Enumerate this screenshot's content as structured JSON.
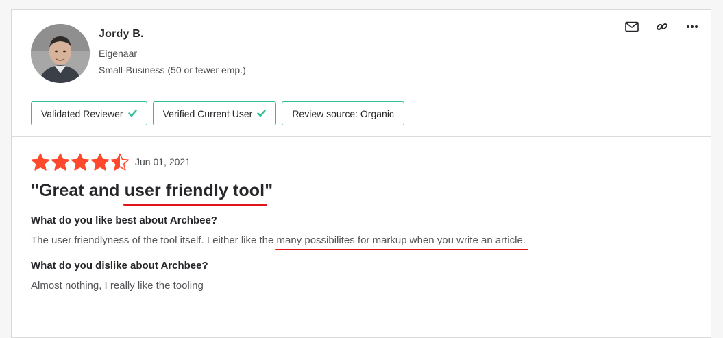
{
  "reviewer": {
    "name": "Jordy B.",
    "role": "Eigenaar",
    "company_size": "Small-Business (50 or fewer emp.)",
    "avatar_icon": "person-avatar"
  },
  "actions": [
    {
      "icon": "mail-icon"
    },
    {
      "icon": "link-icon"
    },
    {
      "icon": "more-icon"
    }
  ],
  "badges": [
    {
      "label": "Validated Reviewer",
      "check": true
    },
    {
      "label": "Verified Current User",
      "check": true
    },
    {
      "label": "Review source: Organic",
      "check": false
    }
  ],
  "colors": {
    "accent": "#2ebd97",
    "star": "#ff492c",
    "highlight": "#e3131c"
  },
  "review": {
    "rating": 4.5,
    "rating_max": 5,
    "date": "Jun 01, 2021",
    "title_pre": "\"Great and ",
    "title_highlight": "user friendly tool",
    "title_post": "\"",
    "q1": "What do you like best about Archbee?",
    "a1_pre": "The user friendlyness of the tool itself. I either like the ",
    "a1_highlight": "many possibilites for markup when you write an article.",
    "q2": "What do you dislike about Archbee?",
    "a2": "Almost nothing, I really like the tooling"
  }
}
